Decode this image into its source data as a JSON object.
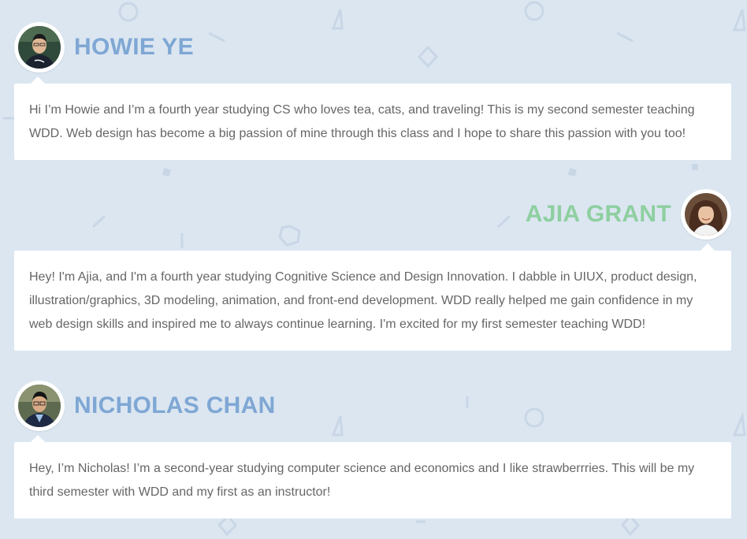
{
  "instructors": [
    {
      "name": "HOWIE YE",
      "bio": "Hi I’m Howie and I’m a fourth year studying CS who loves tea, cats, and traveling! This is my second semester teaching WDD. Web design has become a big passion of mine through this class and I hope to share this passion with you too!",
      "name_color": "#7fa7d4",
      "avatar_side": "left"
    },
    {
      "name": "AJIA GRANT",
      "bio": "Hey! I'm Ajia, and I'm a fourth year studying Cognitive Science and Design Innovation. I dabble in UIUX, product design, illustration/graphics, 3D modeling, animation, and front-end development. WDD really helped me gain confidence in my web design skills and inspired me to always continue learning. I'm excited for my first semester teaching WDD!",
      "name_color": "#8ecfa0",
      "avatar_side": "right"
    },
    {
      "name": "NICHOLAS CHAN",
      "bio": "Hey, I’m Nicholas! I’m a second-year studying computer science and economics and I like strawberrries. This will be my third semester with WDD and my first as an instructor!",
      "name_color": "#7fa7d4",
      "avatar_side": "left"
    }
  ],
  "theme": {
    "background": "#dbe6f1",
    "card_background": "#ffffff",
    "body_text": "#666666",
    "pattern_shapes": "#c9d6e6"
  }
}
